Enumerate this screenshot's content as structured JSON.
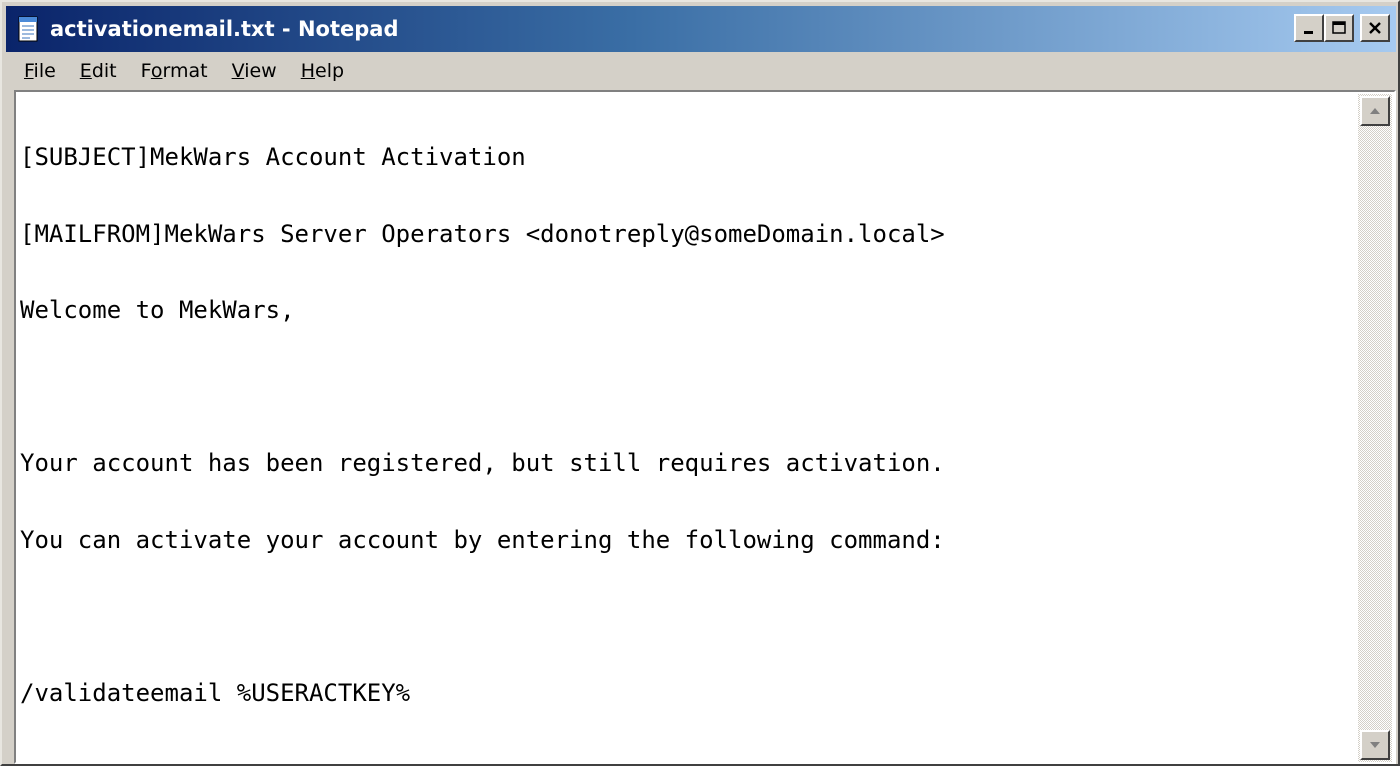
{
  "window": {
    "title": "activationemail.txt - Notepad",
    "controls": [
      "minimize",
      "maximize",
      "close"
    ]
  },
  "menu": {
    "items": [
      {
        "label": "File",
        "accelerator": "F"
      },
      {
        "label": "Edit",
        "accelerator": "E"
      },
      {
        "label": "Format",
        "accelerator": "o"
      },
      {
        "label": "View",
        "accelerator": "V"
      },
      {
        "label": "Help",
        "accelerator": "H"
      }
    ]
  },
  "editor": {
    "lines": [
      "[SUBJECT]MekWars Account Activation",
      "[MAILFROM]MekWars Server Operators <donotreply@someDomain.local>",
      "Welcome to MekWars,",
      "",
      "Your account has been registered, but still requires activation.",
      "You can activate your account by entering the following command:",
      "",
      "/validateemail %USERACTKEY%"
    ]
  },
  "icons": {
    "app": "notepad-icon",
    "minimize": "minimize-icon",
    "maximize": "maximize-icon",
    "close": "close-icon",
    "scroll_up": "arrow-up-icon",
    "scroll_down": "arrow-down-icon"
  },
  "colors": {
    "titlebar_start": "#0a246a",
    "titlebar_end": "#a6caf0",
    "face": "#d4d0c8"
  }
}
